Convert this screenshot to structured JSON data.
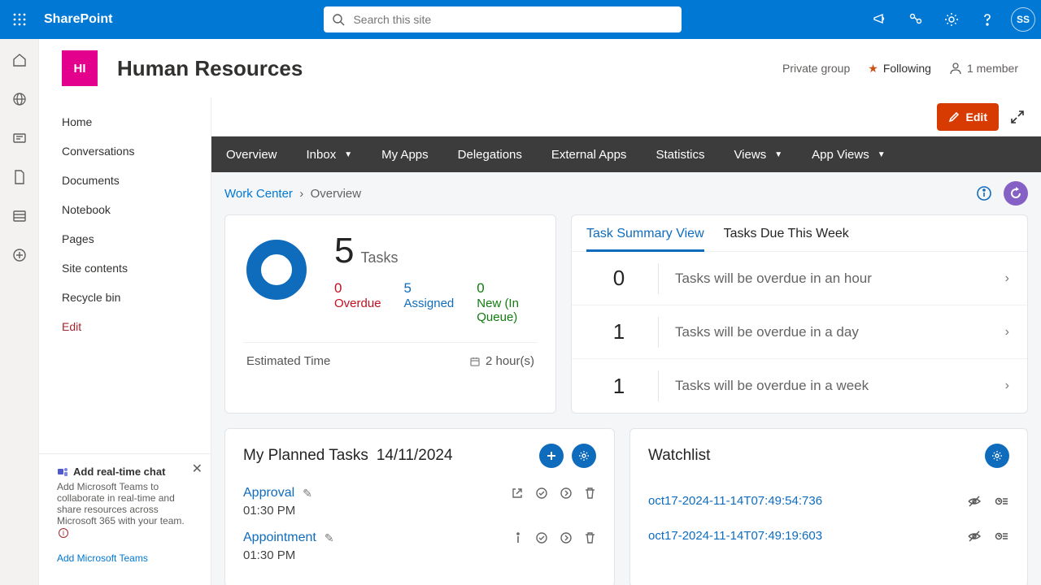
{
  "suite": {
    "brand": "SharePoint",
    "search_placeholder": "Search this site",
    "avatar_initials": "SS"
  },
  "site": {
    "logo_text": "HI",
    "title": "Human Resources",
    "privacy": "Private group",
    "following": "Following",
    "members": "1 member"
  },
  "leftnav": {
    "items": [
      "Home",
      "Conversations",
      "Documents",
      "Notebook",
      "Pages",
      "Site contents",
      "Recycle bin"
    ],
    "edit": "Edit"
  },
  "promo": {
    "title": "Add real-time chat",
    "body": "Add Microsoft Teams to collaborate in real-time and share resources across Microsoft 365 with your team.",
    "link": "Add Microsoft Teams"
  },
  "cmdbar": {
    "edit": "Edit"
  },
  "darknav": {
    "items": [
      "Overview",
      "Inbox",
      "My Apps",
      "Delegations",
      "External Apps",
      "Statistics",
      "Views",
      "App Views"
    ],
    "dropdown_flags": [
      false,
      true,
      false,
      false,
      false,
      false,
      true,
      true
    ]
  },
  "breadcrumb": {
    "root": "Work Center",
    "current": "Overview"
  },
  "tasks_card": {
    "total_num": "5",
    "total_label": "Tasks",
    "overdue_n": "0",
    "overdue_l": "Overdue",
    "assigned_n": "5",
    "assigned_l": "Assigned",
    "new_n": "0",
    "new_l": "New (In Queue)",
    "est_label": "Estimated Time",
    "est_value": "2 hour(s)"
  },
  "summary_card": {
    "tab1": "Task Summary View",
    "tab2": "Tasks Due This Week",
    "rows": [
      {
        "count": "0",
        "text": "Tasks will be overdue in an hour"
      },
      {
        "count": "1",
        "text": "Tasks will be overdue in a day"
      },
      {
        "count": "1",
        "text": "Tasks will be overdue in a week"
      }
    ]
  },
  "planned": {
    "title": "My Planned Tasks",
    "date": "14/11/2024",
    "items": [
      {
        "name": "Approval",
        "time": "01:30 PM"
      },
      {
        "name": "Appointment",
        "time": "01:30 PM"
      }
    ]
  },
  "watchlist": {
    "title": "Watchlist",
    "items": [
      "oct17-2024-11-14T07:49:54:736",
      "oct17-2024-11-14T07:49:19:603"
    ]
  }
}
